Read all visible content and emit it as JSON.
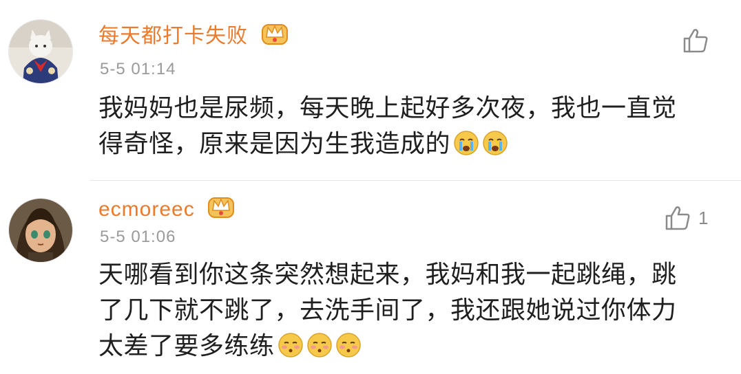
{
  "comments": [
    {
      "username": "每天都打卡失败",
      "timestamp": "5-5 01:14",
      "lines": [
        "我妈妈也是尿频，每天晚上起好多次夜，我也一直觉",
        "得奇怪，原来是因为生我造成的"
      ],
      "emojis": [
        "crying-face",
        "crying-face"
      ],
      "like_count": "",
      "avatar": "cat-figurine-avatar"
    },
    {
      "username": "ecmoreec",
      "timestamp": "5-5 01:06",
      "lines": [
        "天哪看到你这条突然想起来，我妈和我一起跳绳，跳",
        "了几下就不跳了，去洗手间了，我还跟她说过你体力",
        "太差了要多练练"
      ],
      "emojis": [
        "blushing-face",
        "blushing-face",
        "blushing-face"
      ],
      "like_count": "1",
      "avatar": "anime-girl-avatar"
    }
  ],
  "colors": {
    "username": "#ea7a2c",
    "timestamp": "#9a9a9a",
    "text": "#1f1f1f",
    "like": "#8a8a8a"
  }
}
